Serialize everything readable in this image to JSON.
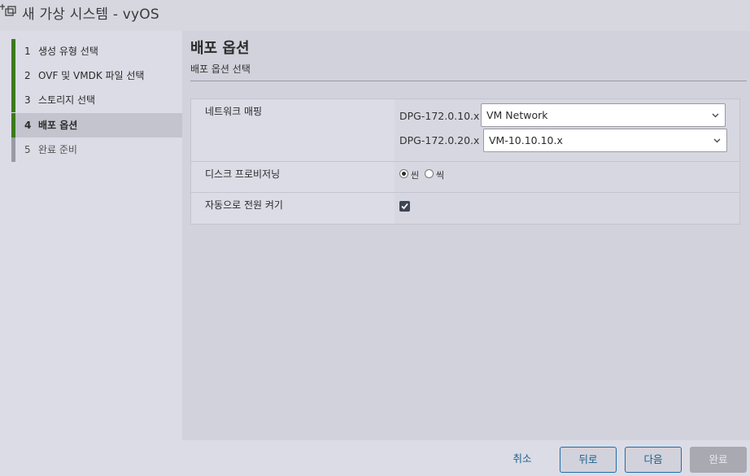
{
  "window": {
    "title": "새 가상 시스템 - vyOS",
    "icon": "vm-add-icon"
  },
  "steps": [
    {
      "num": "1",
      "label": "생성 유형 선택",
      "state": "done"
    },
    {
      "num": "2",
      "label": "OVF 및 VMDK 파일 선택",
      "state": "done"
    },
    {
      "num": "3",
      "label": "스토리지 선택",
      "state": "done"
    },
    {
      "num": "4",
      "label": "배포 옵션",
      "state": "active"
    },
    {
      "num": "5",
      "label": "완료 준비",
      "state": "pending"
    }
  ],
  "main": {
    "heading": "배포 옵션",
    "subheading": "배포 옵션 선택"
  },
  "options": {
    "network": {
      "label": "네트워크 매핑",
      "mappings": [
        {
          "source": "DPG-172.0.10.x",
          "target": "VM Network"
        },
        {
          "source": "DPG-172.0.20.x",
          "target": "VM-10.10.10.x"
        }
      ]
    },
    "disk": {
      "label": "디스크 프로비저닝",
      "choices": [
        {
          "label": "씬",
          "selected": true
        },
        {
          "label": "씩",
          "selected": false
        }
      ]
    },
    "power": {
      "label": "자동으로 전원 켜기",
      "checked": true
    }
  },
  "footer": {
    "cancel": "취소",
    "back": "뒤로",
    "next": "다음",
    "finish": "완료"
  },
  "colors": {
    "accent": "#1d6ea8",
    "complete_step": "#3b7a1c"
  }
}
